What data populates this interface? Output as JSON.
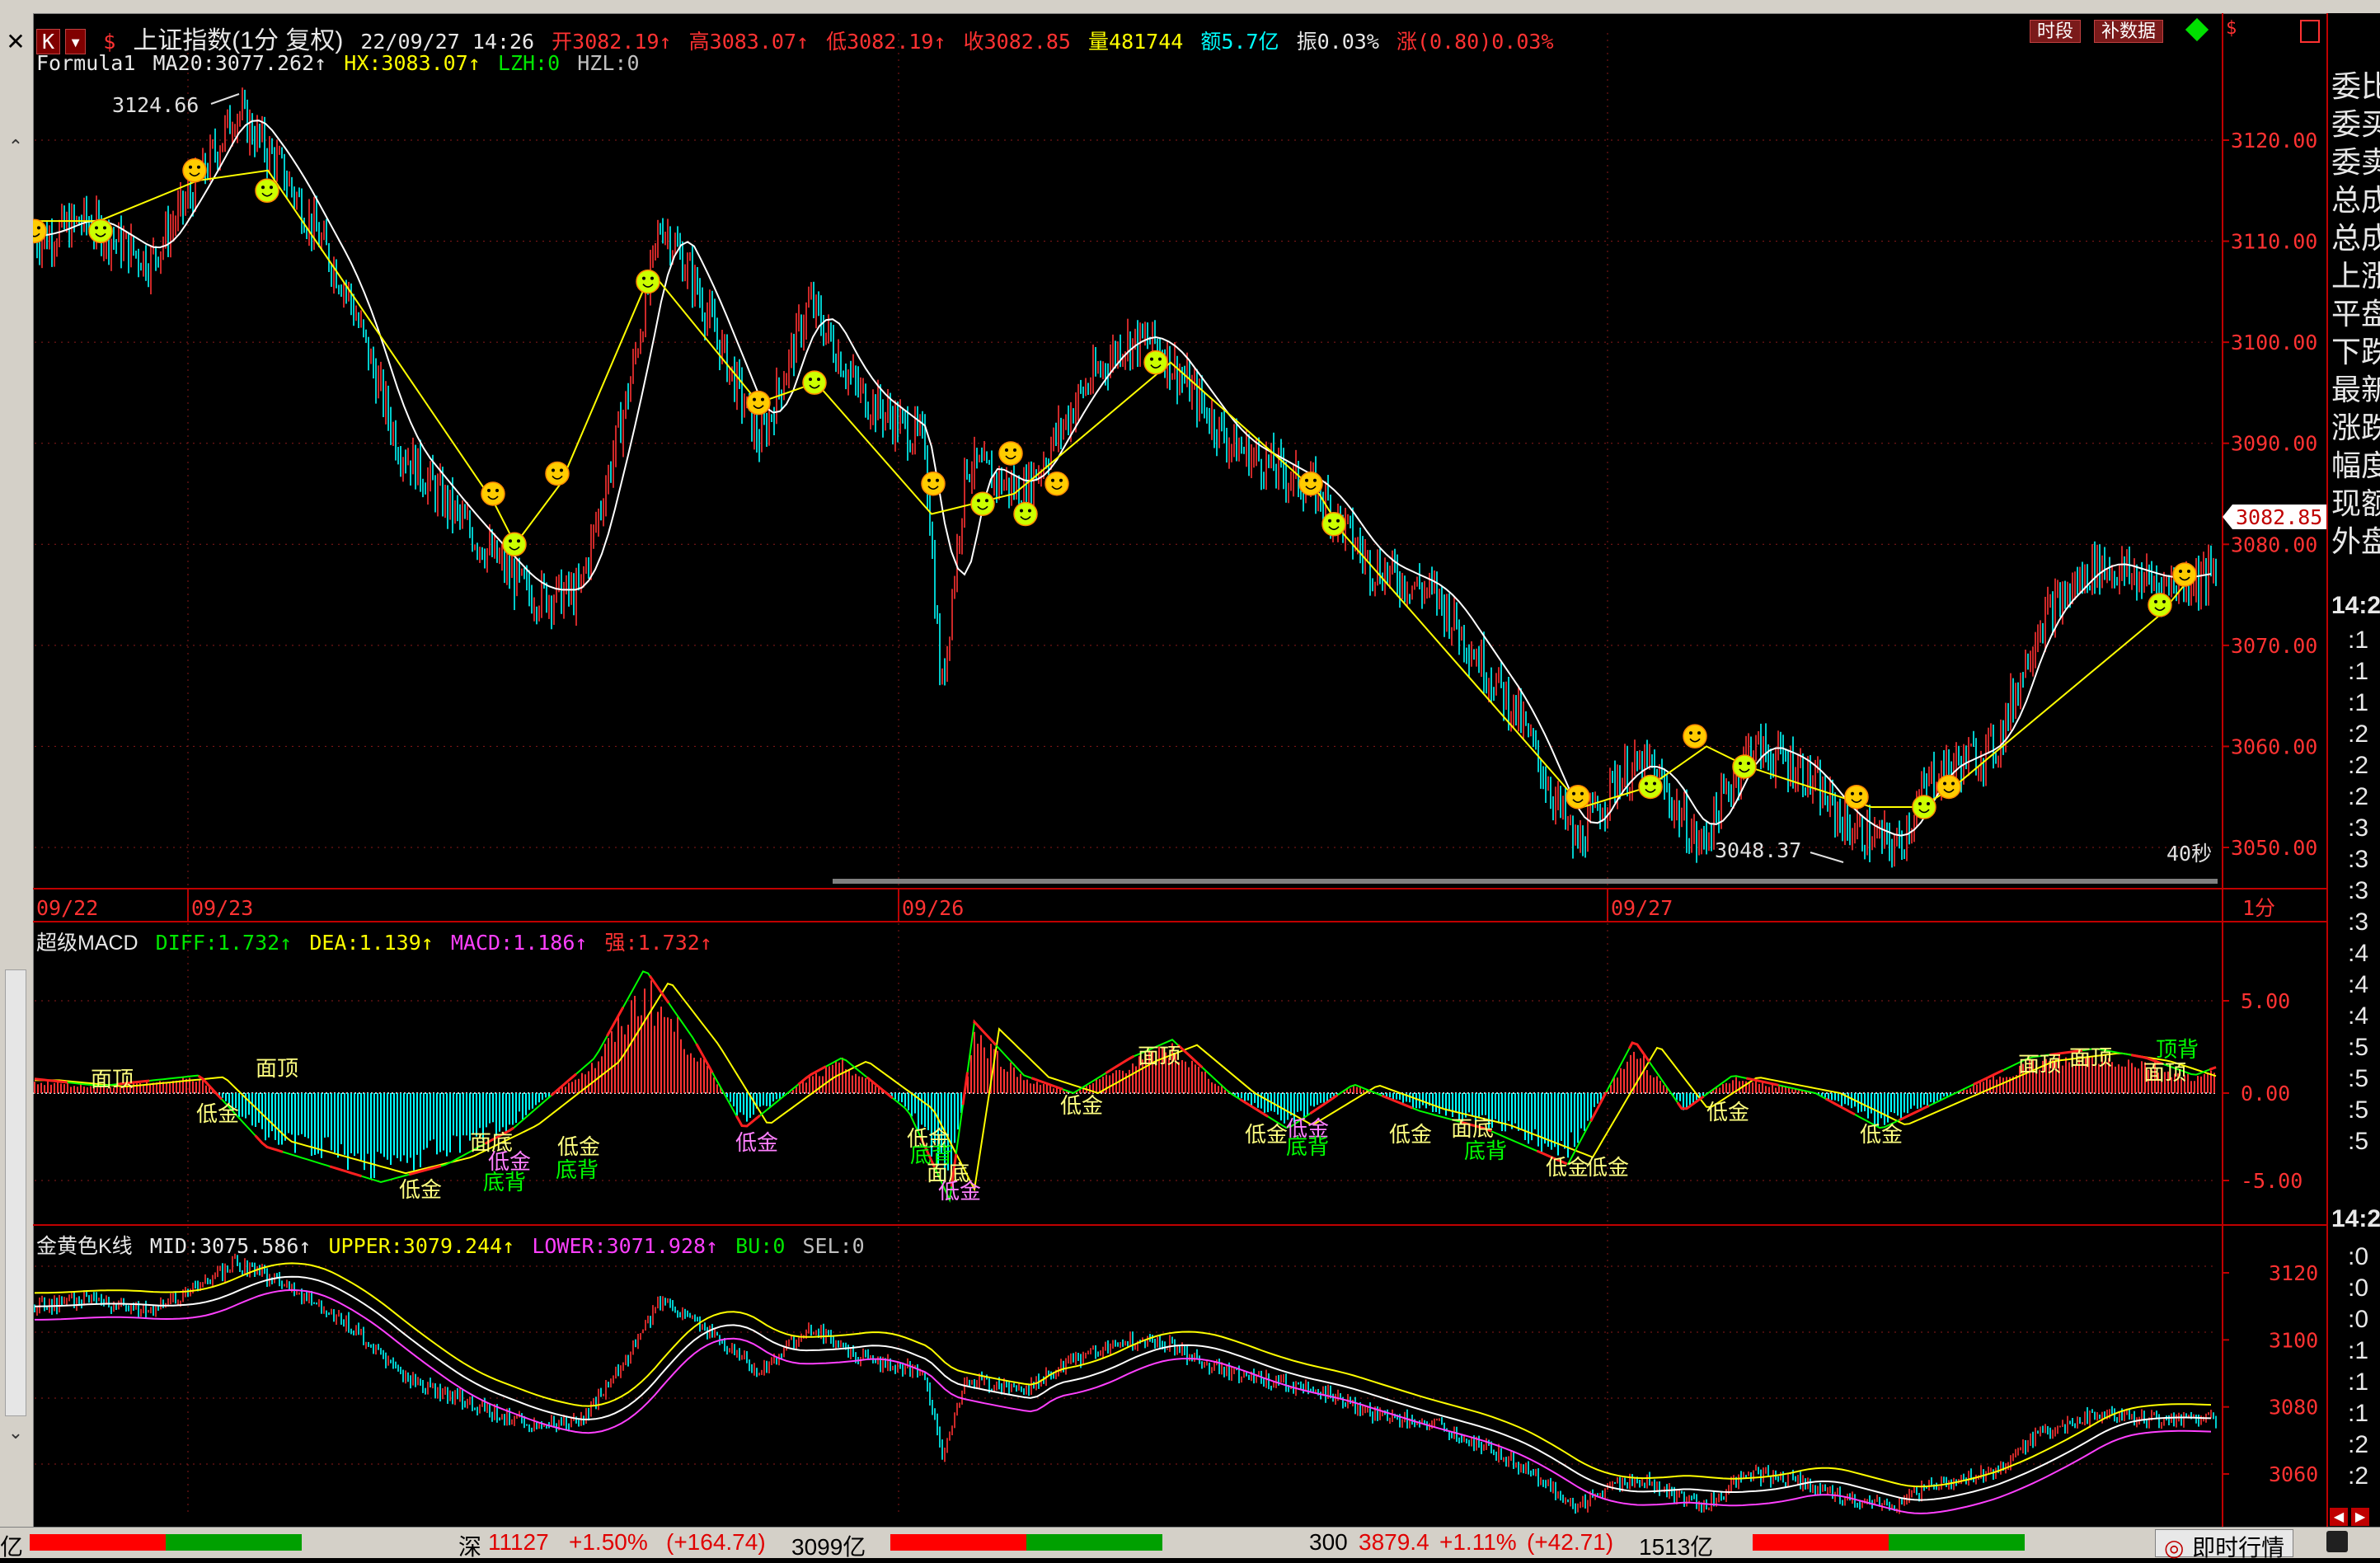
{
  "header": {
    "k_tag": "K",
    "title": "上证指数(1分 复权)",
    "datetime": "22/09/27 14:26",
    "open": "开3082.19",
    "high": "高3083.07",
    "low": "低3082.19",
    "close": "收3082.85",
    "volume": "量481744",
    "amount": "额5.7亿",
    "amplitude": "振0.03%",
    "change": "涨(0.80)0.03%",
    "btn_period": "时段",
    "btn_supplement": "补数据"
  },
  "main_indicator": {
    "name": "Formula1",
    "ma20": "MA20:3077.262↑",
    "hx": "HX:3083.07↑",
    "lzh": "LZH:0",
    "hzl": "HZL:0"
  },
  "main_chart": {
    "high_label": "3124.66",
    "low_label": "3048.37",
    "interval_label": "40秒",
    "current_price": "3082.85",
    "y_ticks": [
      "3120.00",
      "3110.00",
      "3100.00",
      "3090.00",
      "3080.00",
      "3070.00",
      "3060.00",
      "3050.00"
    ],
    "date_labels": [
      "09/22",
      "09/23",
      "09/26",
      "09/27"
    ],
    "period": "1分"
  },
  "macd": {
    "name": "超级MACD",
    "diff": "DIFF:1.732↑",
    "dea": "DEA:1.139↑",
    "macd": "MACD:1.186↑",
    "strong": "强:1.732↑",
    "y_ticks": [
      "5.00",
      "0.00",
      "-5.00"
    ],
    "signals": [
      {
        "t": "面顶",
        "c": "#ffff80",
        "x": 110,
        "y": 1318
      },
      {
        "t": "面顶",
        "c": "#ffff80",
        "x": 310,
        "y": 1305
      },
      {
        "t": "低金",
        "c": "#ffff80",
        "x": 238,
        "y": 1360
      },
      {
        "t": "低金",
        "c": "#ffff80",
        "x": 484,
        "y": 1452
      },
      {
        "t": "面底",
        "c": "#ffff80",
        "x": 570,
        "y": 1395
      },
      {
        "t": "低金",
        "c": "#ff80ff",
        "x": 592,
        "y": 1418
      },
      {
        "t": "底背",
        "c": "#00ff00",
        "x": 586,
        "y": 1443
      },
      {
        "t": "低金",
        "c": "#ffff80",
        "x": 676,
        "y": 1400
      },
      {
        "t": "底背",
        "c": "#00ff00",
        "x": 674,
        "y": 1428
      },
      {
        "t": "低金",
        "c": "#ff80ff",
        "x": 892,
        "y": 1395
      },
      {
        "t": "低金",
        "c": "#ffff80",
        "x": 1100,
        "y": 1390
      },
      {
        "t": "底背",
        "c": "#00ff00",
        "x": 1104,
        "y": 1410
      },
      {
        "t": "面底",
        "c": "#ffff80",
        "x": 1124,
        "y": 1432
      },
      {
        "t": "低金",
        "c": "#ff80ff",
        "x": 1138,
        "y": 1454
      },
      {
        "t": "低金",
        "c": "#ffff80",
        "x": 1286,
        "y": 1350
      },
      {
        "t": "面顶",
        "c": "#ffff80",
        "x": 1380,
        "y": 1290
      },
      {
        "t": "低金",
        "c": "#ffff80",
        "x": 1510,
        "y": 1385
      },
      {
        "t": "低金",
        "c": "#ff80ff",
        "x": 1560,
        "y": 1378
      },
      {
        "t": "底背",
        "c": "#00ff00",
        "x": 1560,
        "y": 1400
      },
      {
        "t": "低金",
        "c": "#ffff80",
        "x": 1685,
        "y": 1385
      },
      {
        "t": "面底",
        "c": "#ffff80",
        "x": 1760,
        "y": 1378
      },
      {
        "t": "底背",
        "c": "#00ff00",
        "x": 1776,
        "y": 1405
      },
      {
        "t": "低金",
        "c": "#ffff80",
        "x": 1875,
        "y": 1425
      },
      {
        "t": "低金",
        "c": "#ffff80",
        "x": 1924,
        "y": 1425
      },
      {
        "t": "低金",
        "c": "#ffff80",
        "x": 2070,
        "y": 1358
      },
      {
        "t": "低金",
        "c": "#ffff80",
        "x": 2256,
        "y": 1385
      },
      {
        "t": "面顶",
        "c": "#ffff80",
        "x": 2448,
        "y": 1300
      },
      {
        "t": "面顶",
        "c": "#ffff80",
        "x": 2510,
        "y": 1292
      },
      {
        "t": "面顶",
        "c": "#ffff80",
        "x": 2600,
        "y": 1310
      },
      {
        "t": "顶背",
        "c": "#00ff00",
        "x": 2615,
        "y": 1282
      }
    ]
  },
  "gold_k": {
    "name": "金黄色K线",
    "mid": "MID:3075.586↑",
    "upper": "UPPER:3079.244↑",
    "lower": "LOWER:3071.928↑",
    "bu": "BU:0",
    "sel": "SEL:0",
    "y_ticks": [
      "3120",
      "3100",
      "3080",
      "3060"
    ]
  },
  "right_panel": {
    "items": [
      "委比",
      "委买",
      "委卖",
      "总成",
      "总成",
      "上涨",
      "平盘",
      "下跌",
      "最新",
      "涨跌",
      "幅度",
      "现额",
      "外盘"
    ],
    "time_header": "14:2",
    "times": [
      ":1",
      ":1",
      ":1",
      ":2",
      ":2",
      ":2",
      ":3",
      ":3",
      ":3",
      ":3",
      ":4",
      ":4",
      ":4",
      ":5",
      ":5",
      ":5",
      ":5"
    ],
    "time_footer": "14:2",
    "times2": [
      ":0",
      ":0",
      ":0",
      ":1",
      ":1",
      ":1",
      ":2",
      ":2"
    ]
  },
  "status_bar": {
    "left_fragment": "亿",
    "shenzhen": "深",
    "sz_value": "11127",
    "sz_pct": "+1.50%",
    "sz_change": "(+164.74)",
    "sz_amount": "3099亿",
    "hs300": "300",
    "hs_value": "3879.4",
    "hs_pct": "+1.11%",
    "hs_change": "(+42.71)",
    "hs_amount": "1513亿",
    "realtime": "即时行情"
  },
  "colors": {
    "up": "#ff3232",
    "down": "#00ffff",
    "ma_white": "#ffffff",
    "zigzag_yellow": "#ffff00",
    "border_red": "#c00000",
    "lower_magenta": "#ff40ff"
  }
}
